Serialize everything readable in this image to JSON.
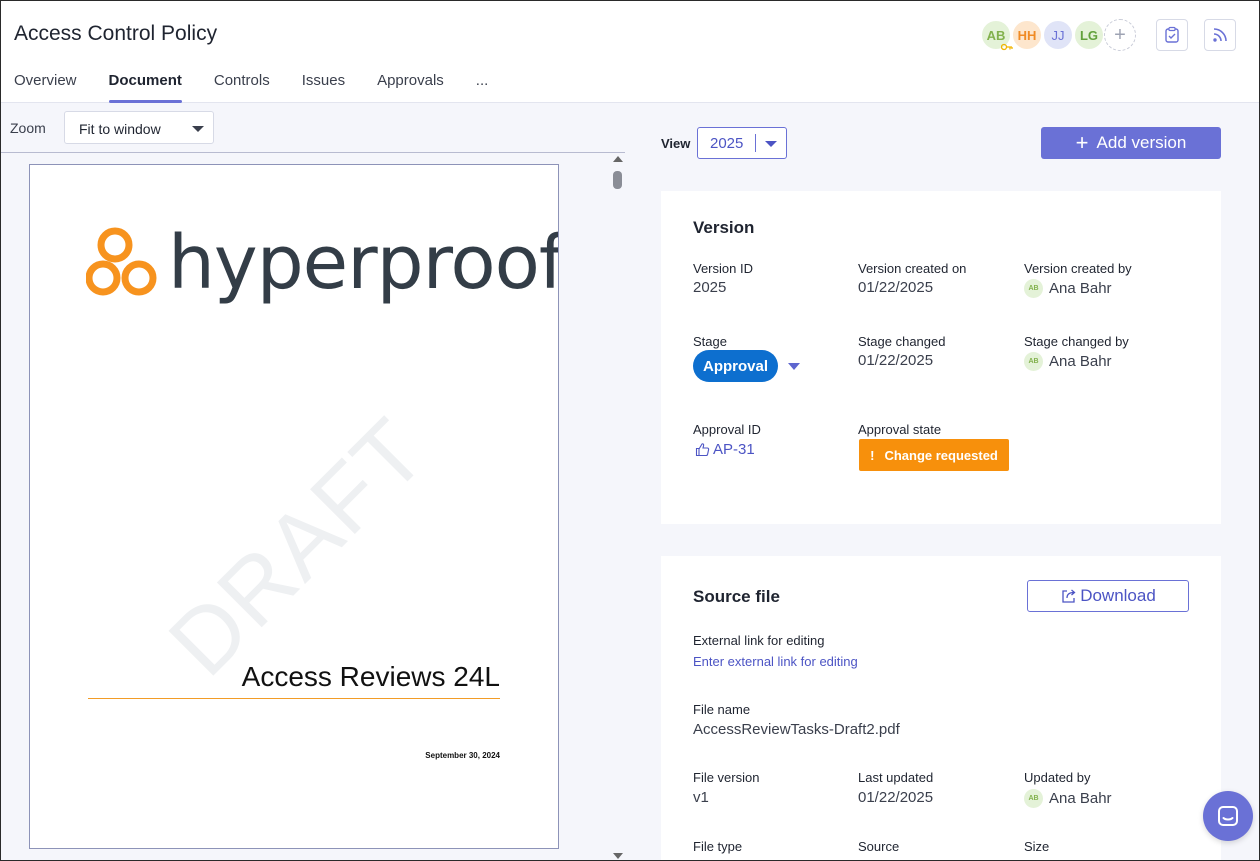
{
  "header": {
    "title": "Access Control Policy",
    "tabs": [
      {
        "label": "Overview",
        "active": false
      },
      {
        "label": "Document",
        "active": true
      },
      {
        "label": "Controls",
        "active": false
      },
      {
        "label": "Issues",
        "active": false
      },
      {
        "label": "Approvals",
        "active": false
      },
      {
        "label": "...",
        "active": false
      }
    ],
    "avatars": [
      "AB",
      "HH",
      "JJ",
      "LG"
    ],
    "add_member_icon": "plus-icon",
    "action_icons": [
      "clipboard-check-icon",
      "rss-feed-icon"
    ]
  },
  "viewer": {
    "zoom_label": "Zoom",
    "zoom_value": "Fit to window",
    "document": {
      "logo_text": "hyperproof",
      "watermark": "DRAFT",
      "title": "Access Reviews 24L",
      "date": "September 30, 2024"
    }
  },
  "toolbar": {
    "view_label": "View",
    "view_value": "2025",
    "add_version_label": "Add version"
  },
  "version_card": {
    "title": "Version",
    "version_id_label": "Version ID",
    "version_id": "2025",
    "created_on_label": "Version created on",
    "created_on": "01/22/2025",
    "created_by_label": "Version created by",
    "created_by": "Ana Bahr",
    "created_by_initials": "AB",
    "stage_label": "Stage",
    "stage": "Approval",
    "stage_changed_label": "Stage changed",
    "stage_changed": "01/22/2025",
    "stage_changed_by_label": "Stage changed by",
    "stage_changed_by": "Ana Bahr",
    "stage_changed_by_initials": "AB",
    "approval_id_label": "Approval ID",
    "approval_id": "AP-31",
    "approval_state_label": "Approval state",
    "approval_state": "Change requested"
  },
  "source_card": {
    "title": "Source file",
    "download_label": "Download",
    "ext_link_label": "External link for editing",
    "ext_link_placeholder": "Enter external link for editing",
    "file_name_label": "File name",
    "file_name": "AccessReviewTasks-Draft2.pdf",
    "file_version_label": "File version",
    "file_version": "v1",
    "last_updated_label": "Last updated",
    "last_updated": "01/22/2025",
    "updated_by_label": "Updated by",
    "updated_by": "Ana Bahr",
    "updated_by_initials": "AB",
    "file_type_label": "File type",
    "source_label": "Source",
    "size_label": "Size"
  },
  "colors": {
    "accent": "#6a71d6",
    "stage_blue": "#0d6fcf",
    "warning_orange": "#f7900c",
    "logo_orange": "#f7931e"
  }
}
